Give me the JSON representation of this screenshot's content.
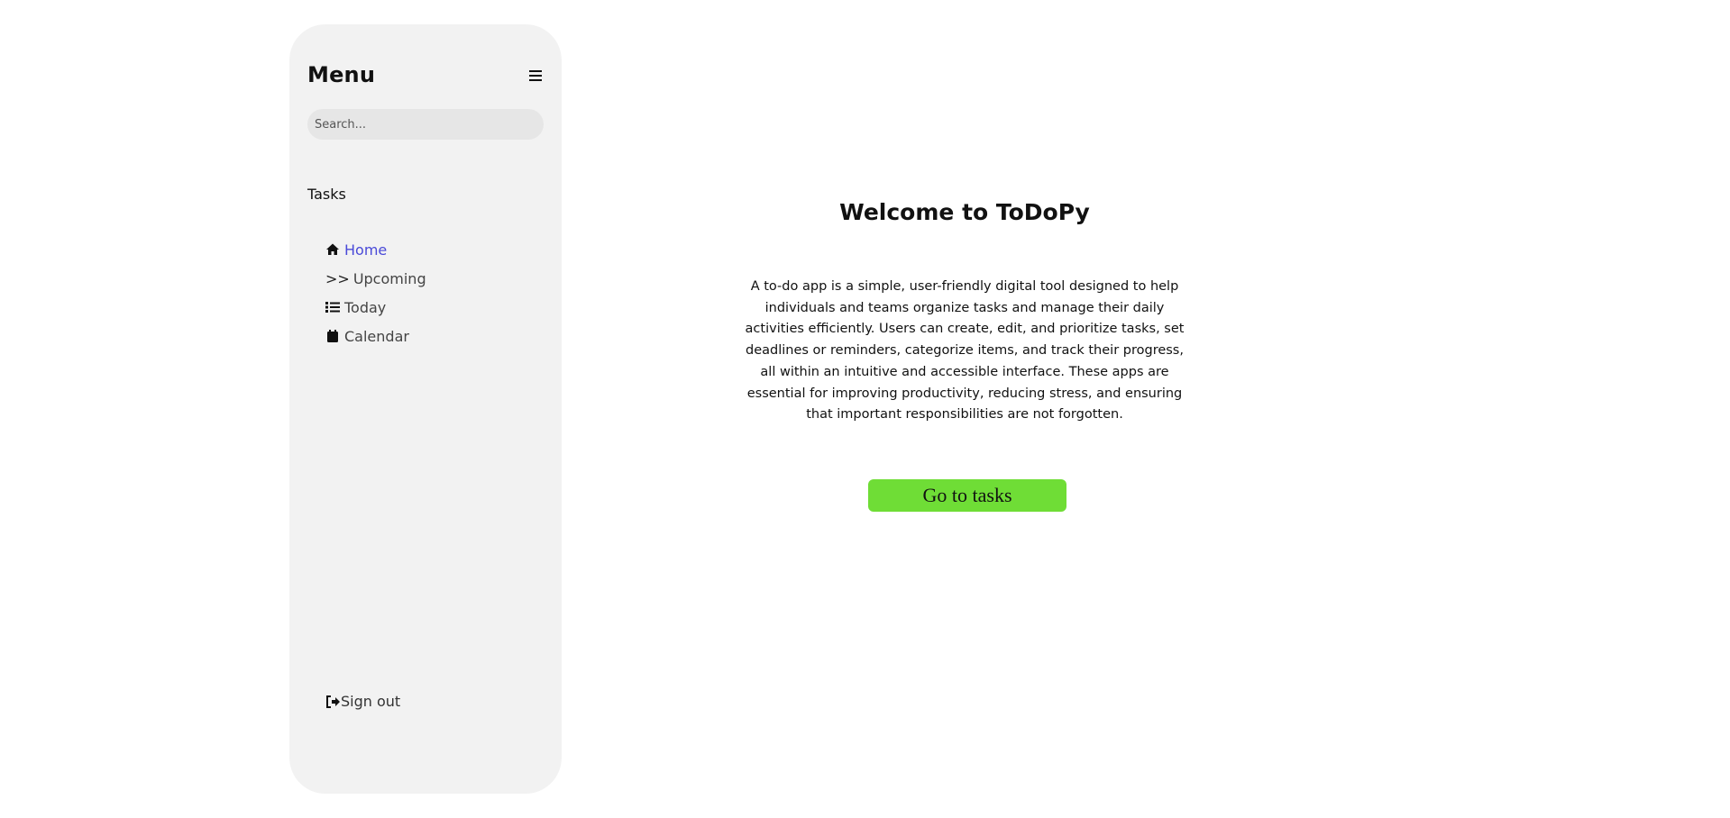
{
  "sidebar": {
    "title": "Menu",
    "search_placeholder": "Search...",
    "section_label": "Tasks",
    "items": [
      {
        "label": "Home",
        "icon": "home-icon",
        "active": true
      },
      {
        "label": "Upcoming",
        "prefix": ">>",
        "active": false
      },
      {
        "label": "Today",
        "icon": "list-icon",
        "active": false
      },
      {
        "label": "Calendar",
        "icon": "calendar-icon",
        "active": false
      }
    ],
    "signout_label": "Sign out"
  },
  "main": {
    "title": "Welcome to ToDoPy",
    "description": "A to-do app is a simple, user-friendly digital tool designed to help individuals and teams organize tasks and manage their daily activities efficiently. Users can create, edit, and prioritize tasks, set deadlines or reminders, categorize items, and track their progress, all within an intuitive and accessible interface. These apps are essential for improving productivity, reducing stress, and ensuring that important responsibilities are not forgotten.",
    "cta_label": "Go to tasks"
  },
  "colors": {
    "sidebar_bg": "#f2f2f2",
    "active_link": "#4a4ad8",
    "cta_bg": "#6fdd36"
  }
}
